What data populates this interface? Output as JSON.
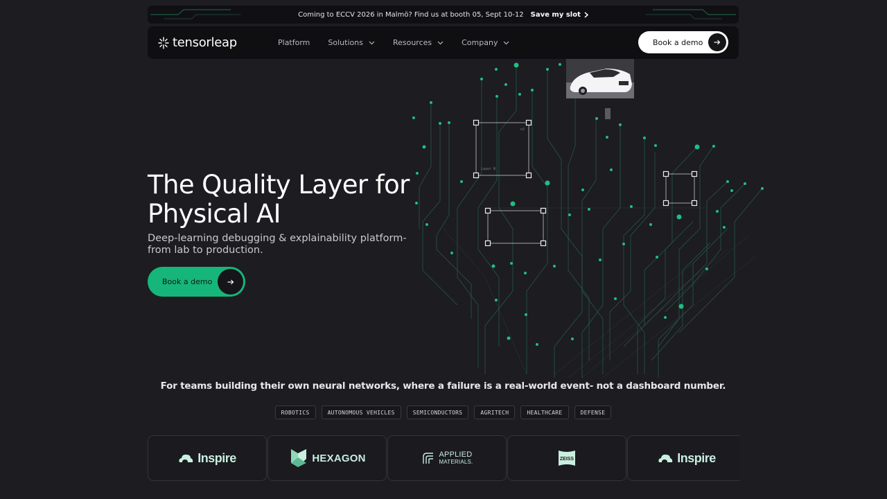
{
  "announcement": {
    "message": "Coming to ECCV 2026 in Malmö? Find us at booth 05, Sept 10-12",
    "cta": "Save my slot"
  },
  "nav": {
    "brand": "tensorleap",
    "items": [
      {
        "label": "Platform",
        "has_dropdown": false
      },
      {
        "label": "Solutions",
        "has_dropdown": true
      },
      {
        "label": "Resources",
        "has_dropdown": true
      },
      {
        "label": "Company",
        "has_dropdown": true
      }
    ],
    "cta": "Book a demo"
  },
  "hero": {
    "title_line1": "The Quality Layer for",
    "title_line2": "Physical AI",
    "subtitle_line1": "Deep-learning debugging & explainability platform-",
    "subtitle_line2": "from lab to production.",
    "cta": "Book a demo",
    "diagram_labels": [
      "Layer N",
      "n2"
    ]
  },
  "teams": {
    "text": "For teams building their own neural networks, where a failure is a real-world event- not a dashboard number.",
    "tags": [
      "ROBOTICS",
      "AUTONOMOUS VEHICLES",
      "SEMICONDUCTORS",
      "AGRITECH",
      "HEALTHCARE",
      "DEFENSE"
    ]
  },
  "logos": [
    {
      "name": "Inspire",
      "icon": "inspire-cloud-icon"
    },
    {
      "name": "HEXAGON",
      "icon": "hexagon-icon"
    },
    {
      "name_line1": "APPLIED",
      "name_line2": "MATERIALS.",
      "icon": "applied-materials-icon"
    },
    {
      "name": "ZEISS",
      "icon": "zeiss-icon"
    },
    {
      "name": "Inspire",
      "icon": "inspire-cloud-icon"
    }
  ],
  "colors": {
    "background": "#1c1c21",
    "accent_green": "#16b57a",
    "logo_tint": "#c9efdf"
  }
}
